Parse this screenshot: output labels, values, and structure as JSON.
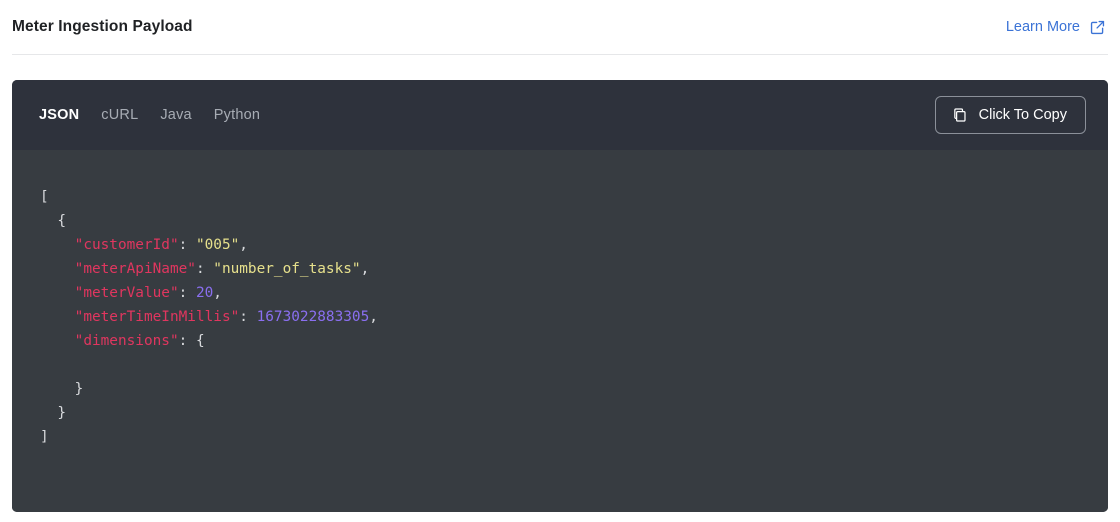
{
  "header": {
    "title": "Meter Ingestion Payload",
    "learn_more_label": "Learn More",
    "learn_more_icon": "external-link-icon",
    "link_color": "#3b73d6"
  },
  "code_panel": {
    "tabs": [
      {
        "label": "JSON",
        "active": true
      },
      {
        "label": "cURL",
        "active": false
      },
      {
        "label": "Java",
        "active": false
      },
      {
        "label": "Python",
        "active": false
      }
    ],
    "copy_button": {
      "label": "Click To Copy",
      "icon": "copy-icon"
    },
    "colors": {
      "header_bg": "#2e323c",
      "body_bg": "#373c41",
      "punctuation": "#d8dadd",
      "key": "#e0365f",
      "string": "#e6e08c",
      "number": "#8a6ff0",
      "tab_active": "#ffffff",
      "tab_inactive": "#a7acb4"
    },
    "code_lines": [
      [
        {
          "t": "punc",
          "v": "["
        }
      ],
      [
        {
          "t": "punc",
          "v": "  {"
        }
      ],
      [
        {
          "t": "punc",
          "v": "    "
        },
        {
          "t": "key",
          "v": "\"customerId\""
        },
        {
          "t": "punc",
          "v": ": "
        },
        {
          "t": "str",
          "v": "\"005\""
        },
        {
          "t": "punc",
          "v": ","
        }
      ],
      [
        {
          "t": "punc",
          "v": "    "
        },
        {
          "t": "key",
          "v": "\"meterApiName\""
        },
        {
          "t": "punc",
          "v": ": "
        },
        {
          "t": "str",
          "v": "\"number_of_tasks\""
        },
        {
          "t": "punc",
          "v": ","
        }
      ],
      [
        {
          "t": "punc",
          "v": "    "
        },
        {
          "t": "key",
          "v": "\"meterValue\""
        },
        {
          "t": "punc",
          "v": ": "
        },
        {
          "t": "num",
          "v": "20"
        },
        {
          "t": "punc",
          "v": ","
        }
      ],
      [
        {
          "t": "punc",
          "v": "    "
        },
        {
          "t": "key",
          "v": "\"meterTimeInMillis\""
        },
        {
          "t": "punc",
          "v": ": "
        },
        {
          "t": "num",
          "v": "1673022883305"
        },
        {
          "t": "punc",
          "v": ","
        }
      ],
      [
        {
          "t": "punc",
          "v": "    "
        },
        {
          "t": "key",
          "v": "\"dimensions\""
        },
        {
          "t": "punc",
          "v": ": {"
        }
      ],
      [
        {
          "t": "punc",
          "v": ""
        }
      ],
      [
        {
          "t": "punc",
          "v": "    }"
        }
      ],
      [
        {
          "t": "punc",
          "v": "  }"
        }
      ],
      [
        {
          "t": "punc",
          "v": "]"
        }
      ]
    ]
  }
}
